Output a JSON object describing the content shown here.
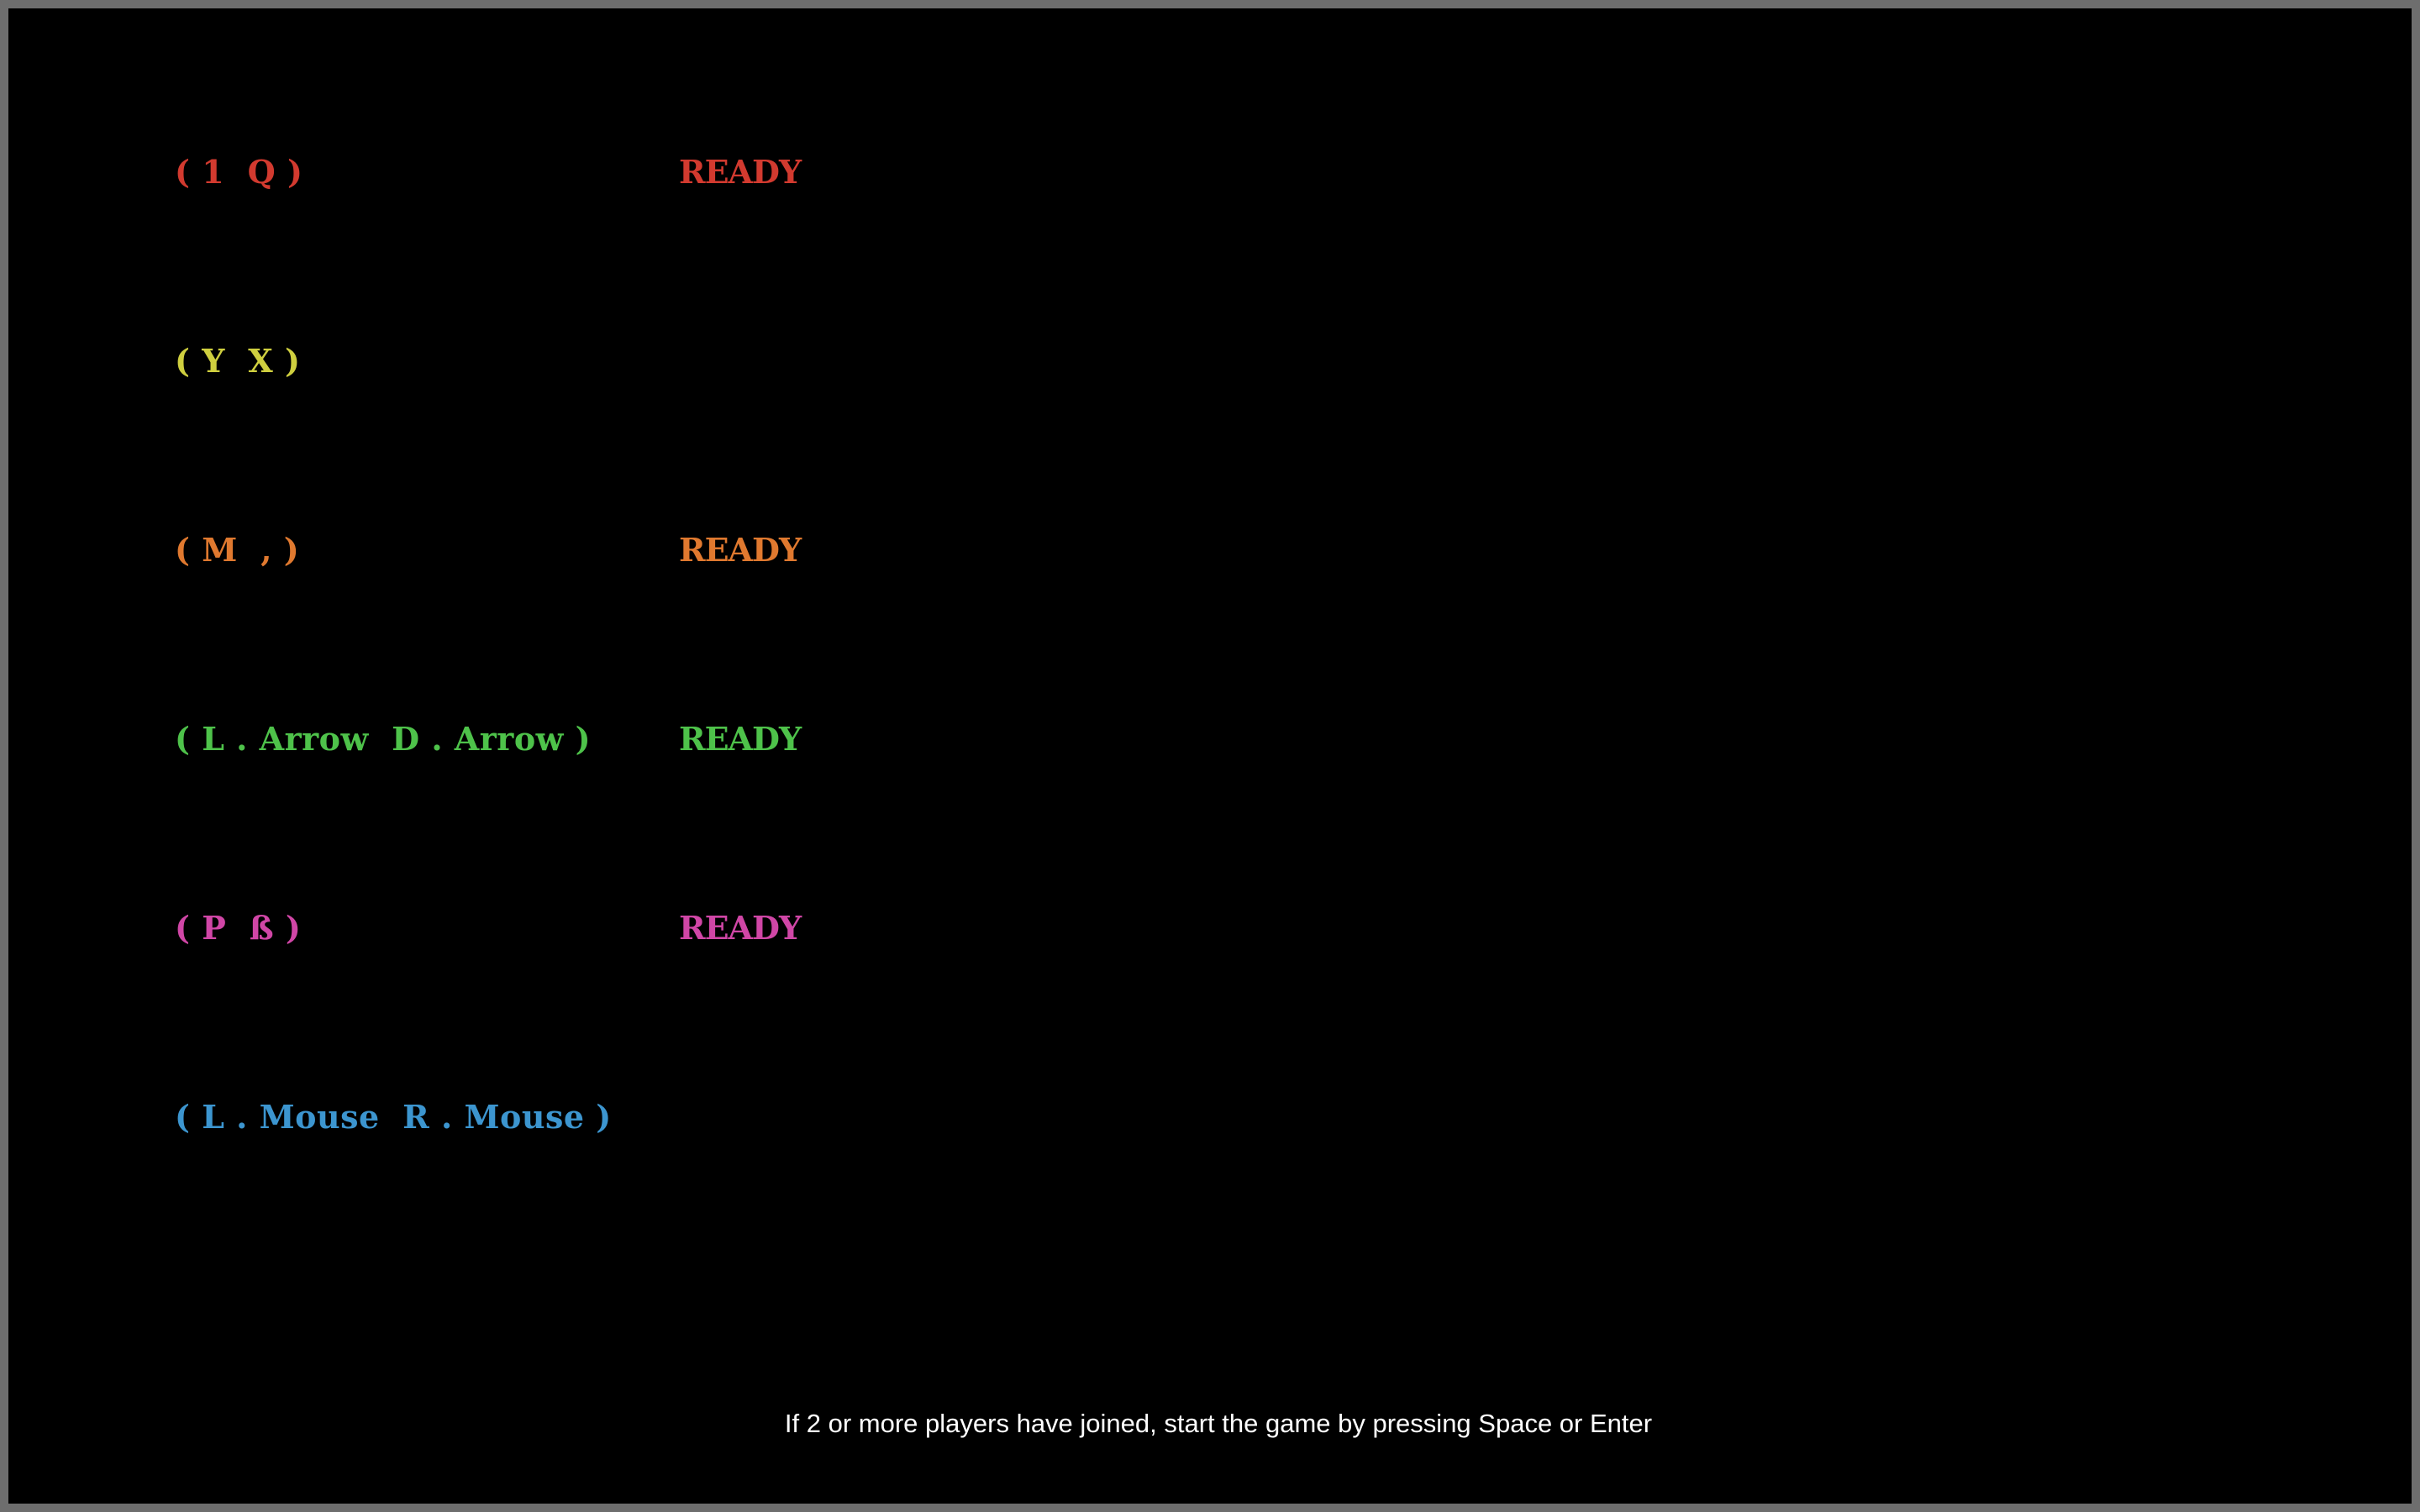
{
  "players": [
    {
      "keys": "( 1  Q )",
      "status": "READY",
      "color": "#d23a2f"
    },
    {
      "keys": "( Y  X )",
      "status": "",
      "color": "#cfcf3f"
    },
    {
      "keys": "( M  , )",
      "status": "READY",
      "color": "#e0792f"
    },
    {
      "keys": "( L . Arrow  D . Arrow )",
      "status": "READY",
      "color": "#4ec24a"
    },
    {
      "keys": "( P  ß )",
      "status": "READY",
      "color": "#d046a6"
    },
    {
      "keys": "( L . Mouse  R . Mouse )",
      "status": "",
      "color": "#3c95cf"
    }
  ],
  "instructions": "If 2 or more players have joined, start the game by pressing Space or Enter"
}
